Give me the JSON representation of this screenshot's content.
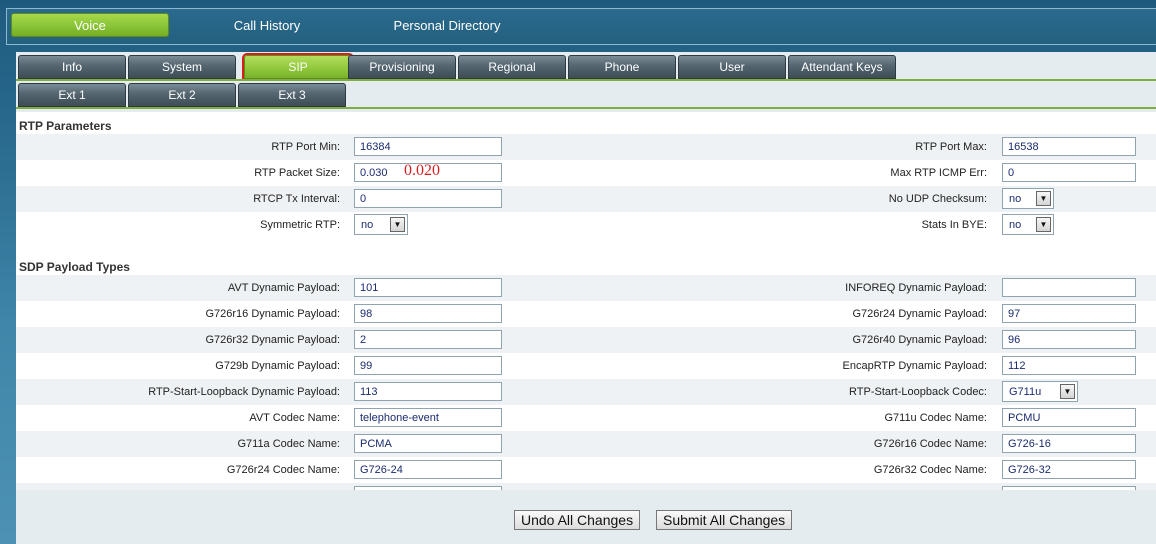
{
  "top_tabs": [
    "Voice",
    "Call History",
    "Personal Directory"
  ],
  "tabs_row1": [
    "Info",
    "System",
    "SIP",
    "Provisioning",
    "Regional",
    "Phone",
    "User",
    "Attendant Keys"
  ],
  "tabs_row2": [
    "Ext 1",
    "Ext 2",
    "Ext 3"
  ],
  "sections": {
    "rtp": "RTP Parameters",
    "sdp": "SDP Payload Types"
  },
  "rtp": {
    "port_min_label": "RTP Port Min:",
    "port_min": "16384",
    "port_max_label": "RTP Port Max:",
    "port_max": "16538",
    "packet_size_label": "RTP Packet Size:",
    "packet_size": "0.030",
    "annotation": "0.020",
    "max_icmp_label": "Max RTP ICMP Err:",
    "max_icmp": "0",
    "rtcp_label": "RTCP Tx Interval:",
    "rtcp": "0",
    "no_udp_label": "No UDP Checksum:",
    "no_udp": "no",
    "symmetric_label": "Symmetric RTP:",
    "symmetric": "no",
    "stats_label": "Stats In BYE:",
    "stats": "no"
  },
  "sdp": {
    "avt_label": "AVT Dynamic Payload:",
    "avt": "101",
    "inforeq_label": "INFOREQ Dynamic Payload:",
    "inforeq": "",
    "g726r16_label": "G726r16 Dynamic Payload:",
    "g726r16": "98",
    "g726r24_label": "G726r24 Dynamic Payload:",
    "g726r24": "97",
    "g726r32_label": "G726r32 Dynamic Payload:",
    "g726r32": "2",
    "g726r40_label": "G726r40 Dynamic Payload:",
    "g726r40": "96",
    "g729b_label": "G729b Dynamic Payload:",
    "g729b": "99",
    "encap_label": "EncapRTP Dynamic Payload:",
    "encap": "112",
    "loopback_label": "RTP-Start-Loopback Dynamic Payload:",
    "loopback": "113",
    "loopback_codec_label": "RTP-Start-Loopback Codec:",
    "loopback_codec": "G711u",
    "avt_codec_label": "AVT Codec Name:",
    "avt_codec": "telephone-event",
    "g711u_codec_label": "G711u Codec Name:",
    "g711u_codec": "PCMU",
    "g711a_codec_label": "G711a Codec Name:",
    "g711a_codec": "PCMA",
    "g726r16_codec_label": "G726r16 Codec Name:",
    "g726r16_codec": "G726-16",
    "g726r24_codec_label": "G726r24 Codec Name:",
    "g726r24_codec": "G726-24",
    "g726r32_codec_label": "G726r32 Codec Name:",
    "g726r32_codec": "G726-32"
  },
  "buttons": {
    "undo": "Undo All Changes",
    "submit": "Submit All Changes"
  },
  "colors": {
    "active_tab": "#92c83e",
    "highlight_border": "#d62020",
    "annotation": "#d42020"
  }
}
